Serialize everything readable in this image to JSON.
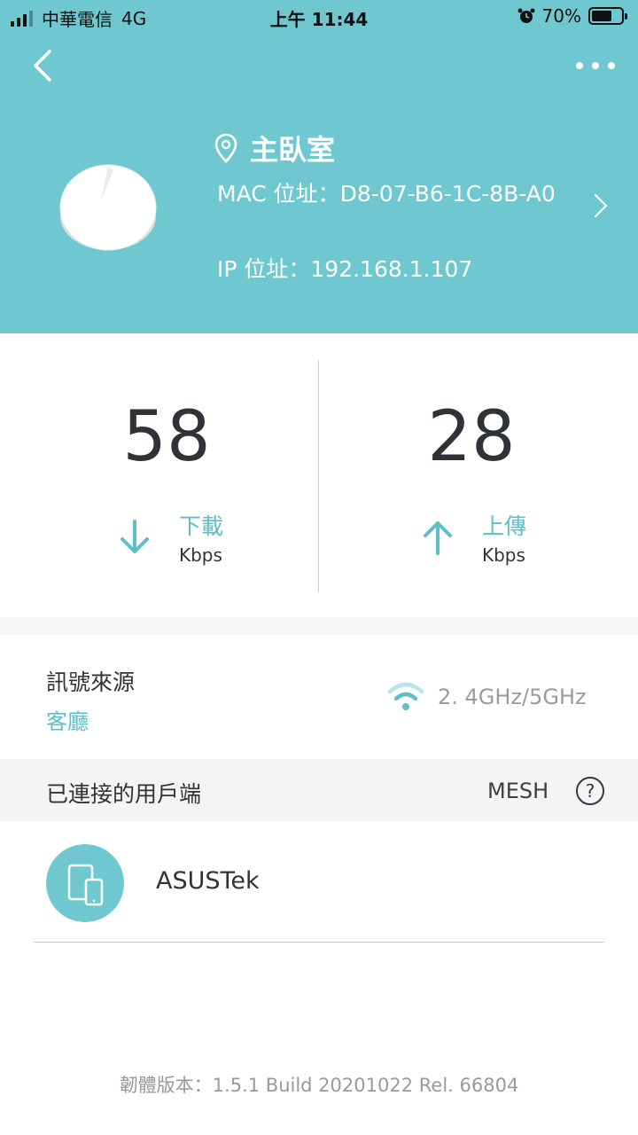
{
  "status_bar": {
    "carrier": "中華電信",
    "network": "4G",
    "time": "上午 11:44",
    "battery": "70%",
    "battery_level": 0.7
  },
  "header": {
    "location_name": "主臥室",
    "mac_label": "MAC 位址：D8-07-B6-1C-8B-A0",
    "ip_label": "IP 位址：192.168.1.107",
    "accent_color": "#6fc8d0"
  },
  "speeds": {
    "download": {
      "value": "58",
      "label": "下載",
      "unit": "Kbps"
    },
    "upload": {
      "value": "28",
      "label": "上傳",
      "unit": "Kbps"
    }
  },
  "signal_source": {
    "title": "訊號來源",
    "value": "客廳",
    "band": "2. 4GHz/5GHz"
  },
  "clients": {
    "title": "已連接的用戶端",
    "mesh_label": "MESH",
    "help_symbol": "?",
    "items": [
      {
        "name": "ASUSTek",
        "icon": "devices-icon"
      }
    ]
  },
  "footer": {
    "firmware": "韌體版本：1.5.1 Build 20201022 Rel. 66804"
  }
}
